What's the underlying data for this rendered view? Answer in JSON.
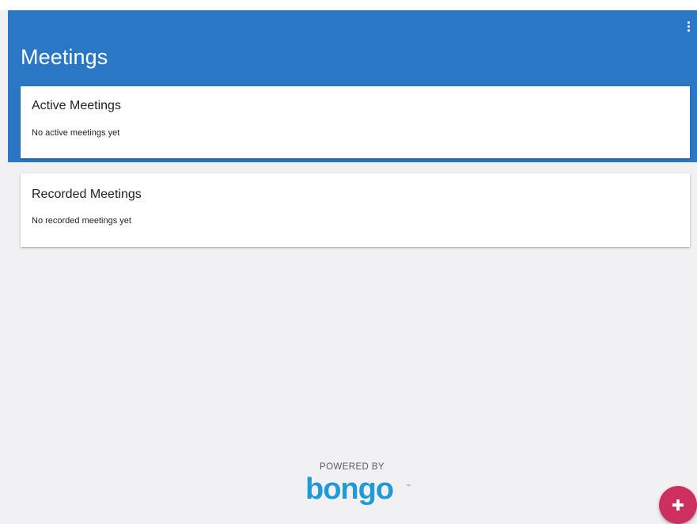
{
  "app": {
    "title": "Meetings",
    "accent_color": "#2a78c5",
    "fab_color": "#cd2f5f"
  },
  "header": {
    "menu_icon": "more-vert-icon"
  },
  "sections": {
    "active": {
      "title": "Active Meetings",
      "empty_text": "No active meetings yet"
    },
    "recorded": {
      "title": "Recorded Meetings",
      "empty_text": "No recorded meetings yet"
    }
  },
  "footer": {
    "powered_by": "POWERED BY",
    "brand": "bongo",
    "brand_color": "#1f9ad6"
  },
  "fab": {
    "icon": "plus-icon"
  }
}
